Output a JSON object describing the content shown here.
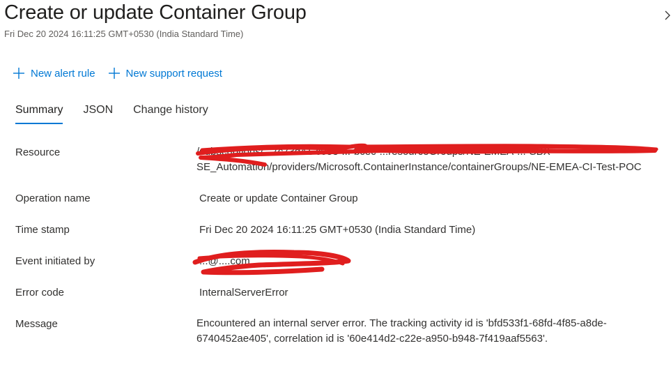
{
  "header": {
    "title": "Create or update Container Group",
    "subtitle": "Fri Dec 20 2024 16:11:25 GMT+0530 (India Standard Time)"
  },
  "toolbar": {
    "new_alert_rule": "New alert rule",
    "new_support_request": "New support request"
  },
  "tabs": [
    {
      "label": "Summary",
      "active": true
    },
    {
      "label": "JSON",
      "active": false
    },
    {
      "label": "Change history",
      "active": false
    }
  ],
  "summary": {
    "resource": {
      "label": "Resource",
      "line1": "/subscriptions/...7c73d41-c053-...-bcec-...resourceGroups/NE-EMEA-...-SBX-",
      "line2": "SE_Automation/providers/Microsoft.ContainerInstance/containerGroups/NE-EMEA-CI-Test-POC"
    },
    "operation_name": {
      "label": "Operation name",
      "value": "Create or update Container Group"
    },
    "time_stamp": {
      "label": "Time stamp",
      "value": "Fri Dec 20 2024 16:11:25 GMT+0530 (India Standard Time)"
    },
    "event_initiated_by": {
      "label": "Event initiated by",
      "value": "...@....com"
    },
    "error_code": {
      "label": "Error code",
      "value": "InternalServerError"
    },
    "message": {
      "label": "Message",
      "value": "Encountered an internal server error. The tracking activity id is 'bfd533f1-68fd-4f85-a8de-6740452ae405', correlation id is '60e414d2-c22e-a950-b948-7f419aaf5563'."
    }
  },
  "colors": {
    "accent": "#0078d4",
    "redaction": "#e01e1e"
  },
  "icons": {
    "add": "add-icon",
    "chevron": "chevron-right-icon"
  }
}
